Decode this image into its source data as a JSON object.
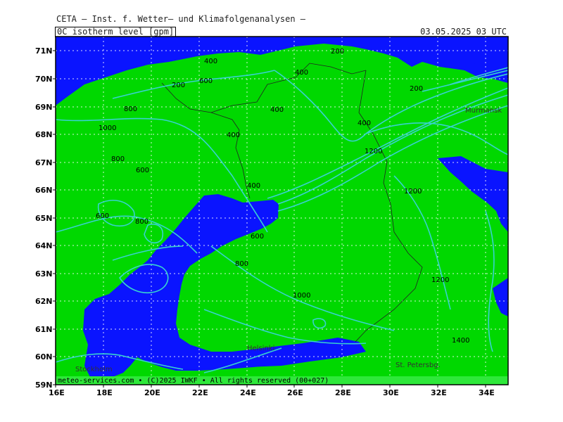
{
  "header": {
    "title": "CETA — Inst. f. Wetter— und Klimafolgenanalysen —",
    "parameter": "0C_isotherm_level_[gpm]",
    "datetime": "03.05.2025 03 UTC"
  },
  "map": {
    "lat_labels": [
      "71N",
      "70N",
      "69N",
      "68N",
      "67N",
      "66N",
      "65N",
      "64N",
      "63N",
      "62N",
      "61N",
      "60N",
      "59N"
    ],
    "lon_labels": [
      "16E",
      "18E",
      "20E",
      "22E",
      "24E",
      "26E",
      "28E",
      "30E",
      "32E",
      "34E"
    ],
    "contour_labels": [
      "200",
      "400",
      "600",
      "400",
      "200",
      "800",
      "1000",
      "400",
      "400",
      "400",
      "200",
      "400",
      "1200",
      "800",
      "600",
      "1200",
      "600",
      "800",
      "600",
      "800",
      "1000",
      "1200",
      "1400"
    ],
    "cities": [
      "Murmansk",
      "Helsinki",
      "Stockholm",
      "St. Petersbg."
    ],
    "credit": "meteo-services.com • (C)2025 IWKF • All rights reserved (00+027)",
    "colors": {
      "land": "#00d800",
      "water": "#0a14ff",
      "contour": "#38d2cf",
      "grid": "#ffffff"
    }
  }
}
